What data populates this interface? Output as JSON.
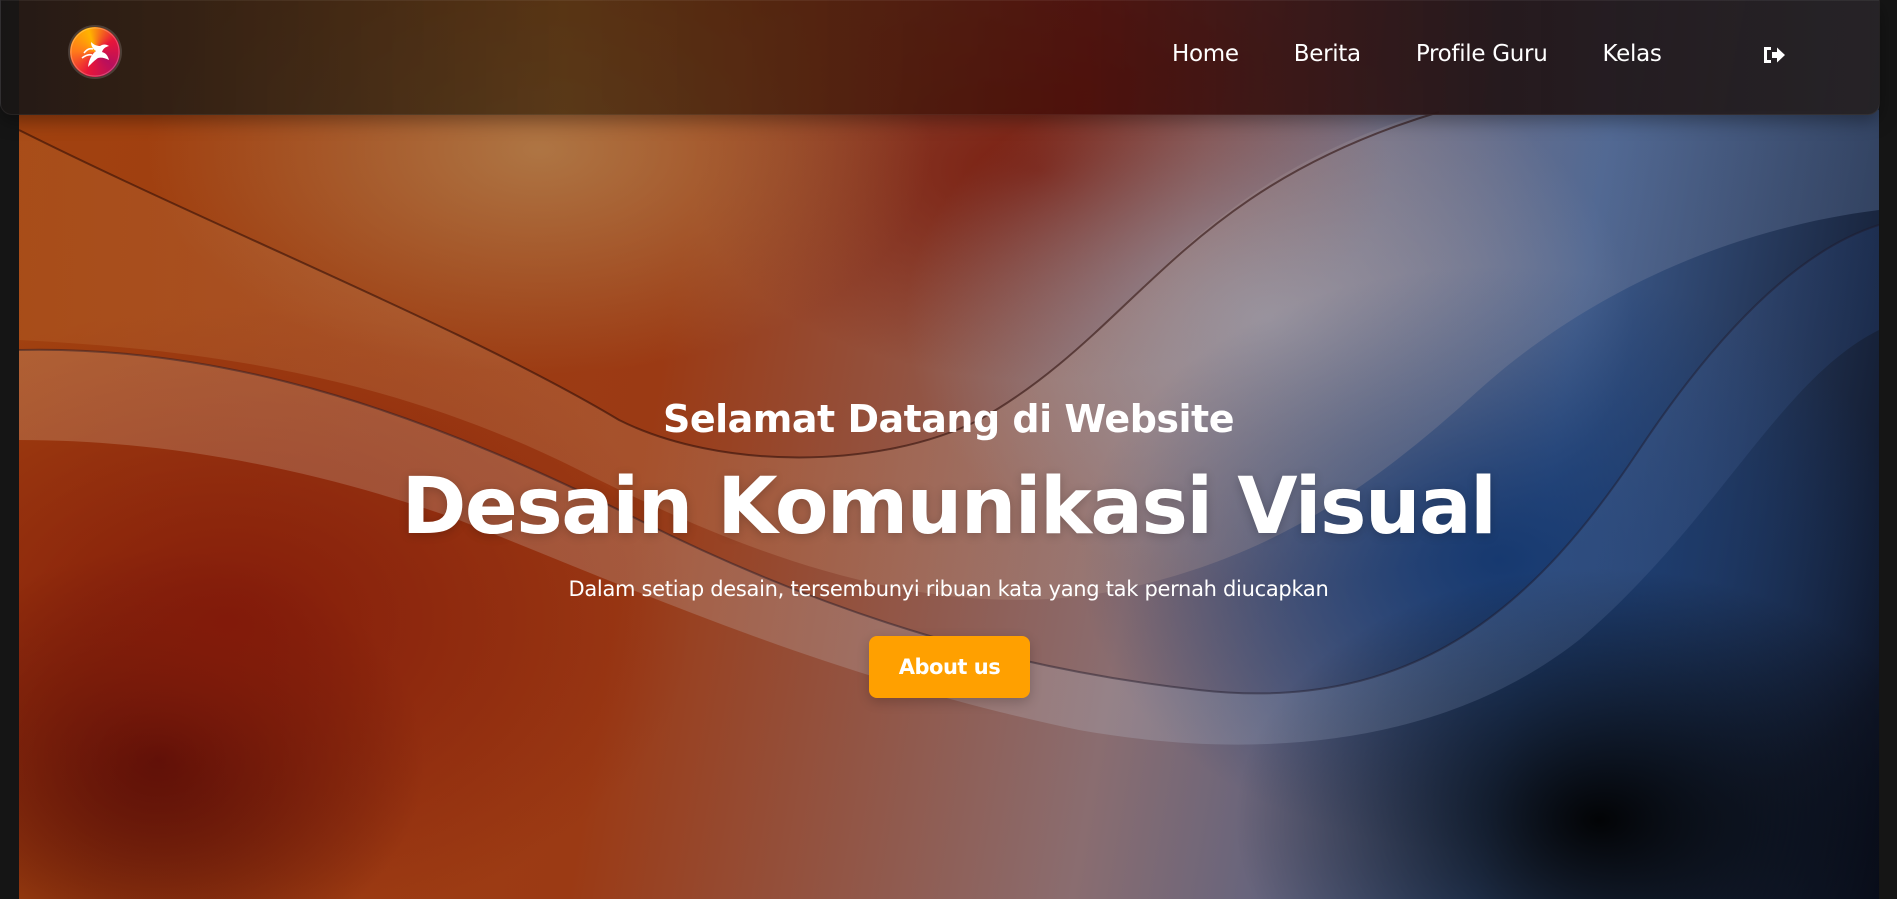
{
  "brand": {
    "logo_icon": "phoenix-logo-icon"
  },
  "nav": {
    "items": [
      {
        "label": "Home"
      },
      {
        "label": "Berita"
      },
      {
        "label": "Profile Guru"
      },
      {
        "label": "Kelas"
      }
    ],
    "logout_icon": "logout-icon"
  },
  "hero": {
    "subtitle": "Selamat Datang di Website",
    "title": "Desain Komunikasi Visual",
    "tagline": "Dalam setiap desain, tersembunyi ribuan kata yang tak pernah diucapkan",
    "cta_label": "About us"
  },
  "colors": {
    "accent": "#ffa000",
    "text": "#ffffff"
  }
}
